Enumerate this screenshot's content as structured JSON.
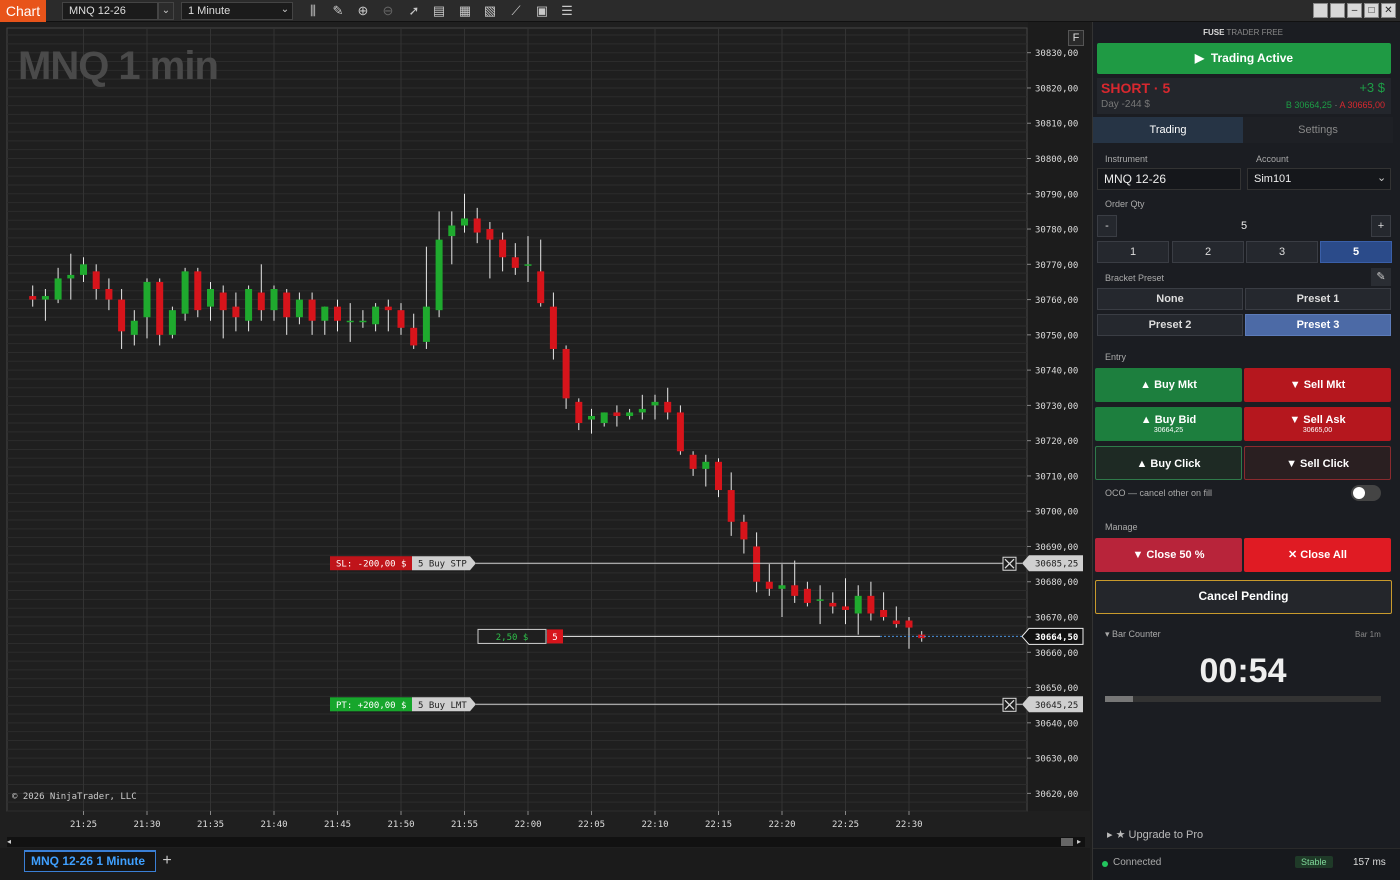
{
  "topbar": {
    "chart_label": "Chart",
    "instrument": "MNQ 12-26",
    "interval": "1 Minute"
  },
  "chart": {
    "title": "MNQ 1 min",
    "copyright": "© 2026 NinjaTrader, LLC",
    "f_button": "F",
    "bottom_tab": "MNQ 12-26 1 Minute",
    "orders": {
      "stop_loss": {
        "label": "SL: -200,00 $",
        "order": "5 Buy STP",
        "price_label": "30685,25",
        "price": 30685.25
      },
      "profit_target": {
        "label": "PT: +200,00 $",
        "order": "5 Buy LMT",
        "price_label": "30645,25",
        "price": 30645.25
      },
      "position": {
        "pnl": "2,50 $",
        "qty": "5",
        "price_label": "30664,50",
        "price": 30664.5
      }
    }
  },
  "chart_data": {
    "type": "candlestick",
    "ylim": [
      30615,
      30837
    ],
    "y_ticks": [
      "30830,00",
      "30820,00",
      "30810,00",
      "30800,00",
      "30790,00",
      "30780,00",
      "30770,00",
      "30760,00",
      "30750,00",
      "30740,00",
      "30730,00",
      "30720,00",
      "30710,00",
      "30700,00",
      "30690,00",
      "30680,00",
      "30670,00",
      "30660,00",
      "30650,00",
      "30640,00",
      "30630,00",
      "30620,00"
    ],
    "y_tick_values": [
      30830,
      30820,
      30810,
      30800,
      30790,
      30780,
      30770,
      30760,
      30750,
      30740,
      30730,
      30720,
      30710,
      30700,
      30690,
      30680,
      30670,
      30660,
      30650,
      30640,
      30630,
      30620
    ],
    "x_ticks": [
      "21:25",
      "21:30",
      "21:35",
      "21:40",
      "21:45",
      "21:50",
      "21:55",
      "22:00",
      "22:05",
      "22:10",
      "22:15",
      "22:20",
      "22:25",
      "22:30"
    ],
    "x_tick_minutes": [
      1285,
      1290,
      1295,
      1300,
      1305,
      1310,
      1315,
      1320,
      1325,
      1330,
      1335,
      1340,
      1345,
      1350
    ],
    "bars": [
      {
        "t": 1281,
        "o": 30761,
        "h": 30764,
        "l": 30758,
        "c": 30760
      },
      {
        "t": 1282,
        "o": 30760,
        "h": 30763,
        "l": 30754,
        "c": 30761
      },
      {
        "t": 1283,
        "o": 30760,
        "h": 30769,
        "l": 30759,
        "c": 30766
      },
      {
        "t": 1284,
        "o": 30766,
        "h": 30773,
        "l": 30760,
        "c": 30767
      },
      {
        "t": 1285,
        "o": 30767,
        "h": 30772,
        "l": 30765,
        "c": 30770
      },
      {
        "t": 1286,
        "o": 30768,
        "h": 30770,
        "l": 30760,
        "c": 30763
      },
      {
        "t": 1287,
        "o": 30763,
        "h": 30766,
        "l": 30757,
        "c": 30760
      },
      {
        "t": 1288,
        "o": 30760,
        "h": 30763,
        "l": 30746,
        "c": 30751
      },
      {
        "t": 1289,
        "o": 30750,
        "h": 30757,
        "l": 30747,
        "c": 30754
      },
      {
        "t": 1290,
        "o": 30755,
        "h": 30766,
        "l": 30749,
        "c": 30765
      },
      {
        "t": 1291,
        "o": 30765,
        "h": 30766,
        "l": 30747,
        "c": 30750
      },
      {
        "t": 1292,
        "o": 30750,
        "h": 30758,
        "l": 30749,
        "c": 30757
      },
      {
        "t": 1293,
        "o": 30756,
        "h": 30769,
        "l": 30754,
        "c": 30768
      },
      {
        "t": 1294,
        "o": 30768,
        "h": 30769,
        "l": 30755,
        "c": 30757
      },
      {
        "t": 1295,
        "o": 30758,
        "h": 30765,
        "l": 30754,
        "c": 30763
      },
      {
        "t": 1296,
        "o": 30762,
        "h": 30764,
        "l": 30749,
        "c": 30757
      },
      {
        "t": 1297,
        "o": 30758,
        "h": 30762,
        "l": 30751,
        "c": 30755
      },
      {
        "t": 1298,
        "o": 30754,
        "h": 30764,
        "l": 30751,
        "c": 30763
      },
      {
        "t": 1299,
        "o": 30762,
        "h": 30770,
        "l": 30754,
        "c": 30757
      },
      {
        "t": 1300,
        "o": 30757,
        "h": 30764,
        "l": 30754,
        "c": 30763
      },
      {
        "t": 1301,
        "o": 30762,
        "h": 30763,
        "l": 30750,
        "c": 30755
      },
      {
        "t": 1302,
        "o": 30755,
        "h": 30762,
        "l": 30753,
        "c": 30760
      },
      {
        "t": 1303,
        "o": 30760,
        "h": 30762,
        "l": 30750,
        "c": 30754
      },
      {
        "t": 1304,
        "o": 30754,
        "h": 30758,
        "l": 30750,
        "c": 30758
      },
      {
        "t": 1305,
        "o": 30758,
        "h": 30760,
        "l": 30751,
        "c": 30754
      },
      {
        "t": 1306,
        "o": 30754,
        "h": 30759,
        "l": 30748,
        "c": 30754
      },
      {
        "t": 1307,
        "o": 30754,
        "h": 30757,
        "l": 30752,
        "c": 30754
      },
      {
        "t": 1308,
        "o": 30753,
        "h": 30759,
        "l": 30751,
        "c": 30758
      },
      {
        "t": 1309,
        "o": 30758,
        "h": 30760,
        "l": 30751,
        "c": 30757
      },
      {
        "t": 1310,
        "o": 30757,
        "h": 30759,
        "l": 30750,
        "c": 30752
      },
      {
        "t": 1311,
        "o": 30752,
        "h": 30756,
        "l": 30746,
        "c": 30747
      },
      {
        "t": 1312,
        "o": 30748,
        "h": 30775,
        "l": 30746,
        "c": 30758
      },
      {
        "t": 1313,
        "o": 30757,
        "h": 30785,
        "l": 30755,
        "c": 30777
      },
      {
        "t": 1314,
        "o": 30778,
        "h": 30785,
        "l": 30770,
        "c": 30781
      },
      {
        "t": 1315,
        "o": 30781,
        "h": 30790,
        "l": 30779,
        "c": 30783
      },
      {
        "t": 1316,
        "o": 30783,
        "h": 30786,
        "l": 30776,
        "c": 30779
      },
      {
        "t": 1317,
        "o": 30780,
        "h": 30782,
        "l": 30766,
        "c": 30777
      },
      {
        "t": 1318,
        "o": 30777,
        "h": 30779,
        "l": 30768,
        "c": 30772
      },
      {
        "t": 1319,
        "o": 30772,
        "h": 30776,
        "l": 30767,
        "c": 30769
      },
      {
        "t": 1320,
        "o": 30770,
        "h": 30778,
        "l": 30765,
        "c": 30770
      },
      {
        "t": 1321,
        "o": 30768,
        "h": 30777,
        "l": 30758,
        "c": 30759
      },
      {
        "t": 1322,
        "o": 30758,
        "h": 30762,
        "l": 30743,
        "c": 30746
      },
      {
        "t": 1323,
        "o": 30746,
        "h": 30747,
        "l": 30729,
        "c": 30732
      },
      {
        "t": 1324,
        "o": 30731,
        "h": 30732,
        "l": 30723,
        "c": 30725
      },
      {
        "t": 1325,
        "o": 30726,
        "h": 30729,
        "l": 30722,
        "c": 30727
      },
      {
        "t": 1326,
        "o": 30725,
        "h": 30728,
        "l": 30724,
        "c": 30728
      },
      {
        "t": 1327,
        "o": 30728,
        "h": 30730,
        "l": 30724,
        "c": 30727
      },
      {
        "t": 1328,
        "o": 30727,
        "h": 30729,
        "l": 30726,
        "c": 30728
      },
      {
        "t": 1329,
        "o": 30728,
        "h": 30733,
        "l": 30726,
        "c": 30729
      },
      {
        "t": 1330,
        "o": 30730,
        "h": 30733,
        "l": 30726,
        "c": 30731
      },
      {
        "t": 1331,
        "o": 30731,
        "h": 30735,
        "l": 30726,
        "c": 30728
      },
      {
        "t": 1332,
        "o": 30728,
        "h": 30730,
        "l": 30716,
        "c": 30717
      },
      {
        "t": 1333,
        "o": 30716,
        "h": 30717,
        "l": 30710,
        "c": 30712
      },
      {
        "t": 1334,
        "o": 30712,
        "h": 30716,
        "l": 30707,
        "c": 30714
      },
      {
        "t": 1335,
        "o": 30714,
        "h": 30715,
        "l": 30704,
        "c": 30706
      },
      {
        "t": 1336,
        "o": 30706,
        "h": 30711,
        "l": 30693,
        "c": 30697
      },
      {
        "t": 1337,
        "o": 30697,
        "h": 30699,
        "l": 30688,
        "c": 30692
      },
      {
        "t": 1338,
        "o": 30690,
        "h": 30694,
        "l": 30677,
        "c": 30680
      },
      {
        "t": 1339,
        "o": 30680,
        "h": 30685,
        "l": 30676,
        "c": 30678
      },
      {
        "t": 1340,
        "o": 30678,
        "h": 30685,
        "l": 30670,
        "c": 30679
      },
      {
        "t": 1341,
        "o": 30679,
        "h": 30686,
        "l": 30674,
        "c": 30676
      },
      {
        "t": 1342,
        "o": 30678,
        "h": 30680,
        "l": 30673,
        "c": 30674
      },
      {
        "t": 1343,
        "o": 30675,
        "h": 30679,
        "l": 30668,
        "c": 30675
      },
      {
        "t": 1344,
        "o": 30674,
        "h": 30677,
        "l": 30671,
        "c": 30673
      },
      {
        "t": 1345,
        "o": 30673,
        "h": 30681,
        "l": 30668,
        "c": 30672
      },
      {
        "t": 1346,
        "o": 30671,
        "h": 30679,
        "l": 30665,
        "c": 30676
      },
      {
        "t": 1347,
        "o": 30676,
        "h": 30680,
        "l": 30669,
        "c": 30671
      },
      {
        "t": 1348,
        "o": 30672,
        "h": 30677,
        "l": 30669,
        "c": 30670
      },
      {
        "t": 1349,
        "o": 30669,
        "h": 30673,
        "l": 30667,
        "c": 30668
      },
      {
        "t": 1350,
        "o": 30669,
        "h": 30670,
        "l": 30661,
        "c": 30667
      },
      {
        "t": 1351,
        "o": 30665,
        "h": 30666,
        "l": 30663,
        "c": 30664
      }
    ]
  },
  "panel": {
    "brand_bold": "FUSE",
    "brand_light": "TRADER FREE",
    "trading_active": "Trading Active",
    "position_side": "SHORT · 5",
    "day_pnl": "Day -244 $",
    "open_pnl": "+3 $",
    "bid": "B 30664,25",
    "sep": " · ",
    "ask": "A 30665,00",
    "tab_trading": "Trading",
    "tab_settings": "Settings",
    "instrument_label": "Instrument",
    "account_label": "Account",
    "instrument_value": "MNQ 12-26",
    "account_value": "Sim101",
    "order_qty_label": "Order Qty",
    "qty_minus": "-",
    "qty_value": "5",
    "qty_plus": "+",
    "qty_presets": [
      "1",
      "2",
      "3",
      "5"
    ],
    "bracket_label": "Bracket Preset",
    "presets": [
      "None",
      "Preset 1",
      "Preset 2",
      "Preset 3"
    ],
    "entry_label": "Entry",
    "buy_mkt": "Buy Mkt",
    "sell_mkt": "Sell Mkt",
    "buy_bid": "Buy Bid",
    "buy_bid_price": "30664,25",
    "sell_ask": "Sell Ask",
    "sell_ask_price": "30665,00",
    "buy_click": "Buy Click",
    "sell_click": "Sell Click",
    "oco_label": "OCO — cancel other on fill",
    "manage_label": "Manage",
    "close_50": "Close 50 %",
    "close_all": "Close All",
    "cancel_pending": "Cancel Pending",
    "bar_counter_label": "Bar Counter",
    "bar_interval": "Bar 1m",
    "bar_timer": "00:54",
    "bar_progress": 0.1,
    "upgrade": "Upgrade to Pro",
    "status": "Connected",
    "stable": "Stable",
    "latency": "157 ms"
  },
  "colors": {
    "up": "#1faa2e",
    "down": "#d7141b",
    "accent": "#e8541a",
    "sl": "#c0141a",
    "pt": "#17a62c"
  }
}
